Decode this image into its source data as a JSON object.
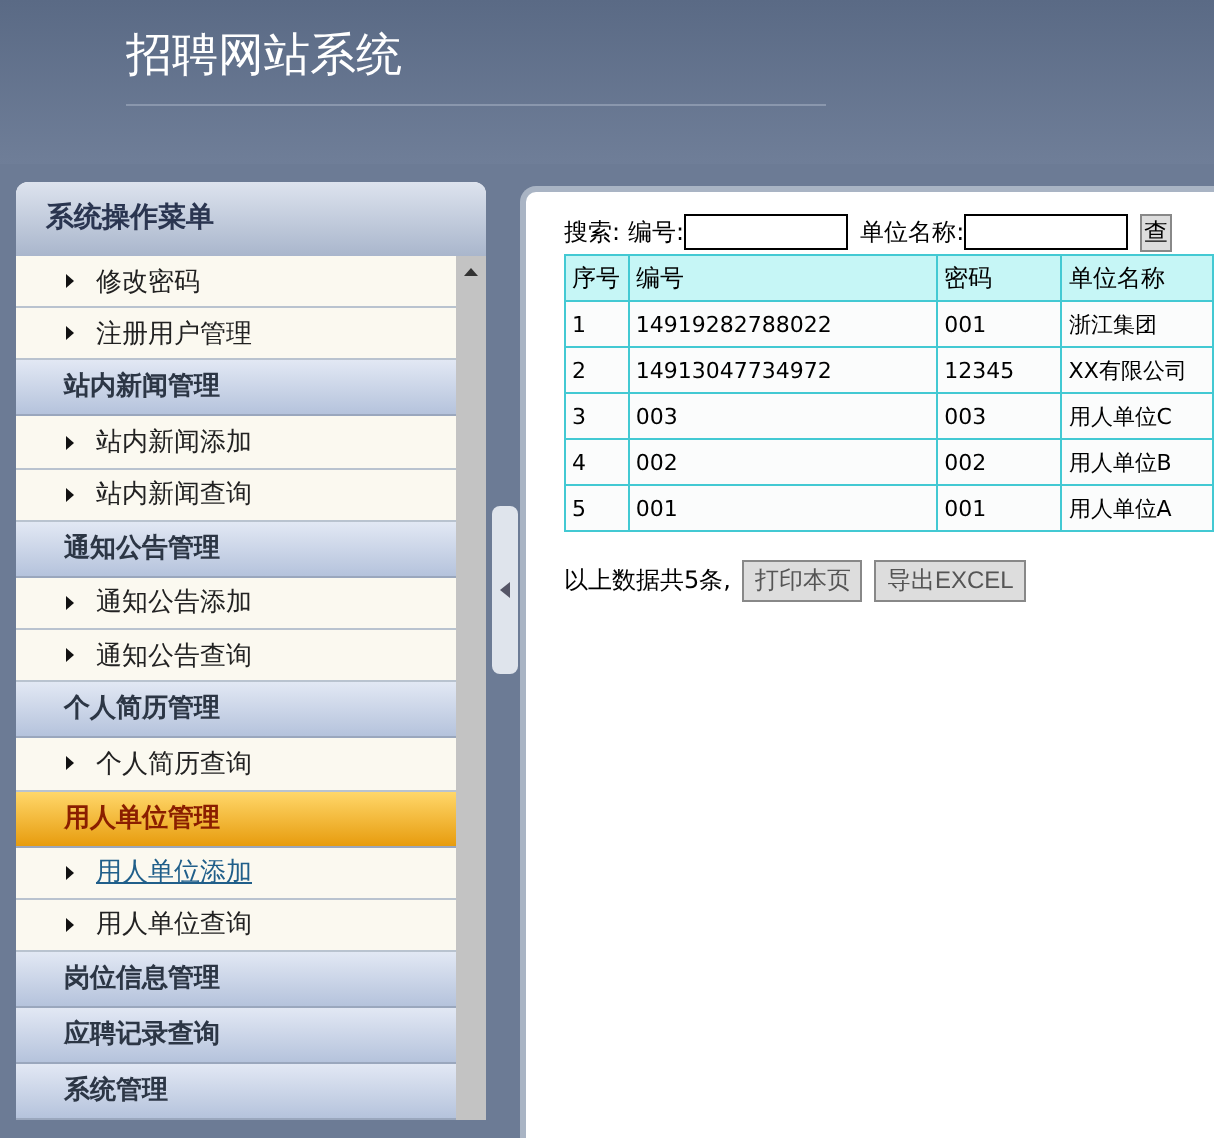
{
  "header": {
    "title": "招聘网站系统"
  },
  "menu": {
    "title": "系统操作菜单",
    "groups": [
      {
        "items": [
          {
            "label": "修改密码",
            "hovered": false
          },
          {
            "label": "注册用户管理",
            "hovered": false
          }
        ]
      },
      {
        "label": "站内新闻管理",
        "selected": false,
        "items": [
          {
            "label": "站内新闻添加",
            "hovered": false
          },
          {
            "label": "站内新闻查询",
            "hovered": false
          }
        ]
      },
      {
        "label": "通知公告管理",
        "selected": false,
        "items": [
          {
            "label": "通知公告添加",
            "hovered": false
          },
          {
            "label": "通知公告查询",
            "hovered": false
          }
        ]
      },
      {
        "label": "个人简历管理",
        "selected": false,
        "items": [
          {
            "label": "个人简历查询",
            "hovered": false
          }
        ]
      },
      {
        "label": "用人单位管理",
        "selected": true,
        "items": [
          {
            "label": "用人单位添加",
            "hovered": true
          },
          {
            "label": "用人单位查询",
            "hovered": false
          }
        ]
      },
      {
        "label": "岗位信息管理",
        "selected": false
      },
      {
        "label": "应聘记录查询",
        "selected": false
      },
      {
        "label": "系统管理",
        "selected": false
      }
    ]
  },
  "search": {
    "label": "搜索:",
    "fields": [
      {
        "label": "编号:"
      },
      {
        "label": "单位名称:"
      }
    ],
    "button": "查"
  },
  "table": {
    "columns": [
      "序号",
      "编号",
      "密码",
      "单位名称"
    ],
    "rows": [
      [
        "1",
        "14919282788022",
        "001",
        "浙江集团"
      ],
      [
        "2",
        "14913047734972",
        "12345",
        "XX有限公司"
      ],
      [
        "3",
        "003",
        "003",
        "用人单位C"
      ],
      [
        "4",
        "002",
        "002",
        "用人单位B"
      ],
      [
        "5",
        "001",
        "001",
        "用人单位A"
      ]
    ]
  },
  "footer": {
    "summary": "以上数据共5条,",
    "buttons": [
      "打印本页",
      "导出EXCEL"
    ]
  }
}
